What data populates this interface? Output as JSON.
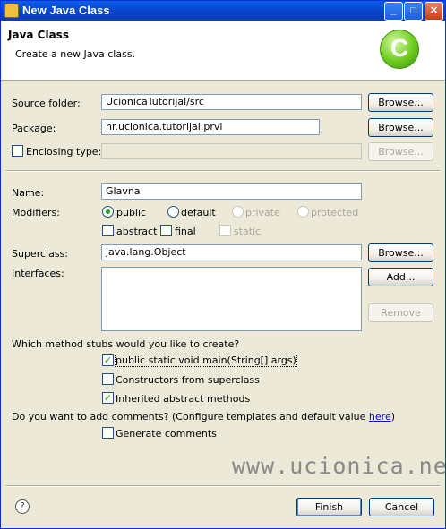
{
  "window": {
    "title": "New Java Class",
    "minimize": "_",
    "maximize": "□",
    "close": "✕"
  },
  "header": {
    "title": "Java Class",
    "description": "Create a new Java class.",
    "logo_letter": "C"
  },
  "source_folder": {
    "label": "Source folder:",
    "value": "UcionicaTutorijal/src",
    "browse": "Browse..."
  },
  "package": {
    "label": "Package:",
    "value": "hr.ucionica.tutorijal.prvi",
    "browse": "Browse..."
  },
  "enclosing_type": {
    "label": "Enclosing type:",
    "value": "",
    "browse": "Browse...",
    "checked": false
  },
  "name": {
    "label": "Name:",
    "value": "Glavna"
  },
  "modifiers": {
    "label": "Modifiers:",
    "public": "public",
    "default": "default",
    "private": "private",
    "protected": "protected",
    "abstract": "abstract",
    "final": "final",
    "static": "static",
    "selected": "public"
  },
  "superclass": {
    "label": "Superclass:",
    "value": "java.lang.Object",
    "browse": "Browse..."
  },
  "interfaces": {
    "label": "Interfaces:",
    "add": "Add...",
    "remove": "Remove"
  },
  "stubs": {
    "question": "Which method stubs would you like to create?",
    "main": "public static void main(String[] args)",
    "constructors": "Constructors from superclass",
    "inherited": "Inherited abstract methods",
    "main_checked": true,
    "constructors_checked": false,
    "inherited_checked": true
  },
  "comments": {
    "question": "Do you want to add comments? (Configure templates and default value ",
    "link": "here",
    "question_end": ")",
    "generate": "Generate comments",
    "generate_checked": false
  },
  "watermark": "www.ucionica.net",
  "footer": {
    "help": "?",
    "finish": "Finish",
    "cancel": "Cancel"
  }
}
